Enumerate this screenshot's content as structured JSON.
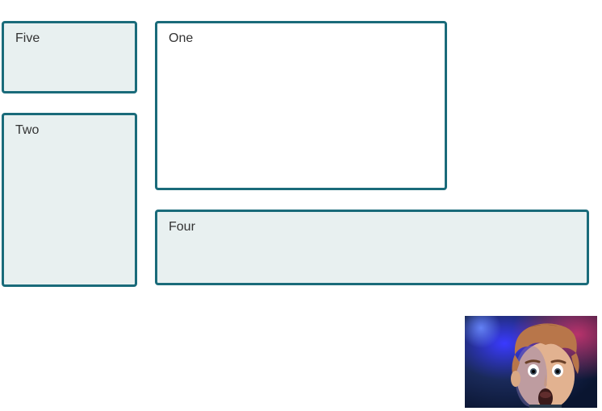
{
  "boxes": {
    "five": {
      "label": "Five"
    },
    "one": {
      "label": "One"
    },
    "two": {
      "label": "Two"
    },
    "four": {
      "label": "Four"
    }
  },
  "thumbnail": {
    "description": "surprised-face-thumbnail"
  }
}
